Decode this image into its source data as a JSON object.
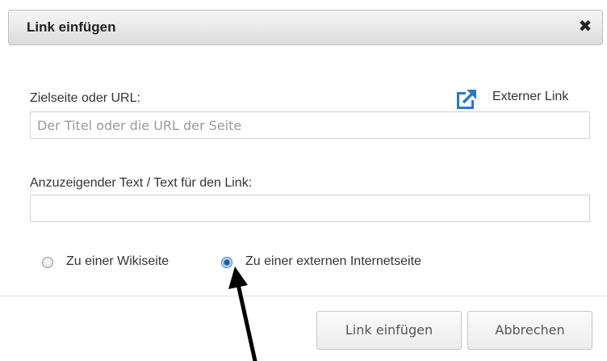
{
  "dialog": {
    "title": "Link einfügen",
    "close_symbol": "✖",
    "close_icon": "close-icon"
  },
  "target": {
    "label": "Zielseite oder URL:",
    "placeholder": "Der Titel oder die URL der Seite",
    "value": ""
  },
  "external_link": {
    "label": "Externer Link",
    "icon": "external-link-icon",
    "color": "#2a78c8"
  },
  "link_text": {
    "label": "Anzuzeigender Text / Text für den Link:",
    "value": ""
  },
  "link_type": {
    "options": [
      {
        "label": "Zu einer Wikiseite",
        "checked": false
      },
      {
        "label": "Zu einer externen Internetseite",
        "checked": true
      }
    ]
  },
  "buttons": {
    "insert_label": "Link einfügen",
    "cancel_label": "Abbrechen"
  },
  "annotation": {
    "icon": "pointer-arrow-icon",
    "color": "#000000"
  }
}
